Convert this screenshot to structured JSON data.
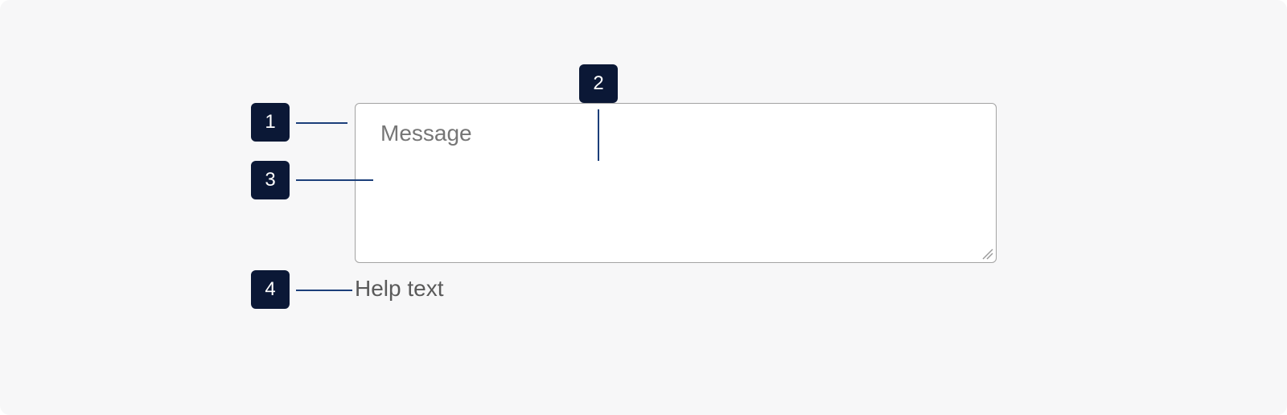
{
  "textarea": {
    "placeholder": "Message",
    "help_text": "Help text"
  },
  "markers": [
    "1",
    "2",
    "3",
    "4"
  ],
  "colors": {
    "background": "#f7f7f8",
    "marker_fill": "#0b1836",
    "leader_line": "#1c3f7a",
    "textarea_border": "#a3a3a3",
    "placeholder_text": "#767676",
    "help_text": "#5a5a5a"
  },
  "icons": {
    "resize": "resize-handle-icon"
  }
}
